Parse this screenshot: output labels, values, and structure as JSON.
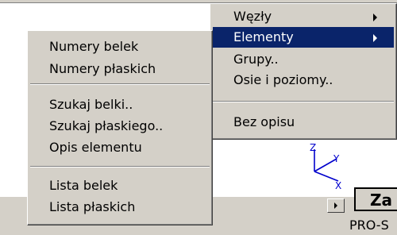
{
  "main_menu": {
    "items": [
      {
        "label": "Węzły",
        "has_submenu": true,
        "selected": false
      },
      {
        "label": "Elementy",
        "has_submenu": true,
        "selected": true
      },
      {
        "label": "Grupy..",
        "has_submenu": false,
        "selected": false
      },
      {
        "label": "Osie i poziomy..",
        "has_submenu": false,
        "selected": false
      },
      {
        "label": "Bez opisu",
        "has_submenu": false,
        "selected": false
      }
    ]
  },
  "submenu": {
    "items": [
      {
        "label": "Numery belek"
      },
      {
        "label": "Numery płaskich"
      },
      {
        "label": "Szukaj belki.."
      },
      {
        "label": "Szukaj płaskiego.."
      },
      {
        "label": "Opis elementu"
      },
      {
        "label": "Lista belek"
      },
      {
        "label": "Lista płaskich"
      }
    ]
  },
  "axis": {
    "z": "Z",
    "y": "Y",
    "x": "X"
  },
  "background": {
    "button_label": "Za",
    "status_text": "PRO-S"
  },
  "colors": {
    "menu_bg": "#d4d0c8",
    "highlight": "#0a246a",
    "highlight_text": "#ffffff"
  }
}
